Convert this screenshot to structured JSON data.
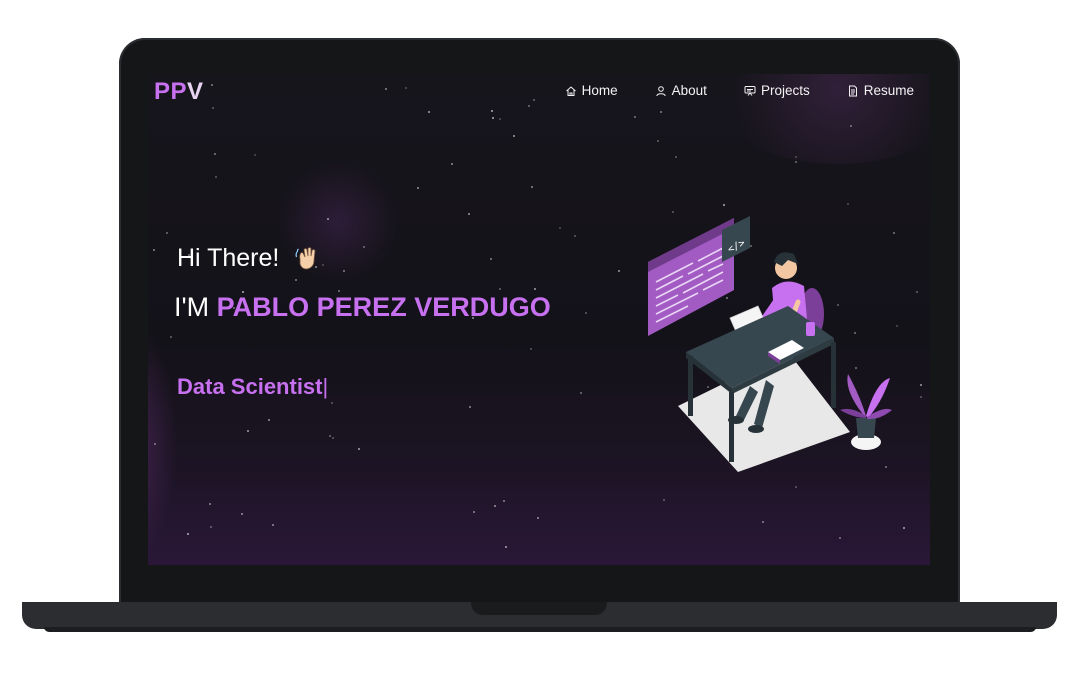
{
  "navbar": {
    "logo_prefix": "PP",
    "logo_suffix": "V",
    "items": [
      {
        "label": "Home",
        "icon": "home-icon"
      },
      {
        "label": "About",
        "icon": "user-icon"
      },
      {
        "label": "Projects",
        "icon": "projects-icon"
      },
      {
        "label": "Resume",
        "icon": "document-icon"
      }
    ]
  },
  "hero": {
    "greeting": "Hi There!",
    "intro_prefix": "I'M",
    "name": "PABLO PEREZ VERDUGO",
    "role": "Data Scientist",
    "cursor": "|",
    "code_tag": "</>"
  },
  "colors": {
    "accent": "#c770f0",
    "background": "#17151c",
    "bezel": "#141618"
  }
}
